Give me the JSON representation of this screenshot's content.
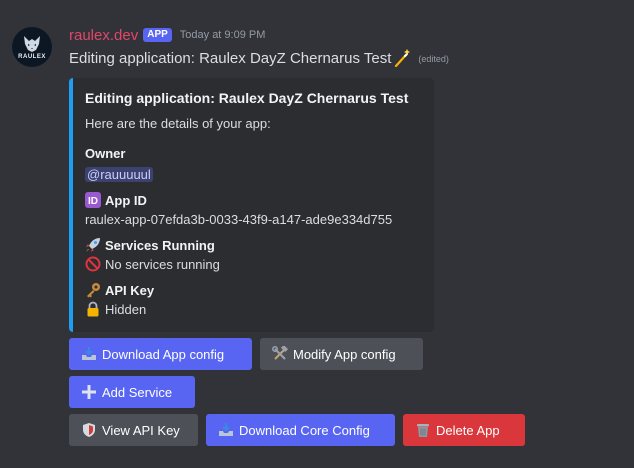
{
  "message": {
    "username": "raulex.dev",
    "badge": "APP",
    "timestamp": "Today at 9:09 PM",
    "content": "Editing application: Raulex DayZ Chernarus Test",
    "edited": "(edited)",
    "avatar_text": "RAULEX"
  },
  "embed": {
    "accent_color": "#1e9ef3",
    "title": "Editing application: Raulex DayZ Chernarus Test",
    "description": "Here are the details of your app:",
    "fields": {
      "owner": {
        "name": "Owner",
        "value": "@rauuuuul"
      },
      "app_id": {
        "name": "App ID",
        "value": "raulex-app-07efda3b-0033-43f9-a147-ade9e334d755"
      },
      "services": {
        "name": "Services Running",
        "value": "No services running"
      },
      "api_key": {
        "name": "API Key",
        "value": "Hidden"
      }
    }
  },
  "buttons": {
    "download_app_config": "Download App config",
    "modify_app_config": "Modify App config",
    "add_service": "Add Service",
    "view_api_key": "View API Key",
    "download_core_config": "Download Core Config",
    "delete_app": "Delete App"
  },
  "colors": {
    "primary": "#5865f2",
    "secondary": "#4e5058",
    "danger": "#da373c",
    "username": "#e2466a"
  }
}
